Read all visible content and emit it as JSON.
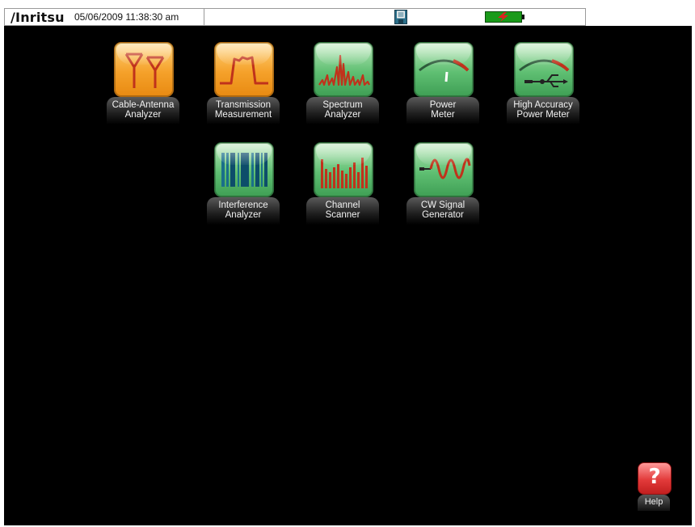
{
  "header": {
    "brand": "/Inritsu",
    "datetime": "05/06/2009 11:38:30 am",
    "save_icon": "floppy-disk-icon",
    "battery_icon": "battery-charging-icon",
    "battery_color": "#1a9a1a",
    "charge_color": "#e02020"
  },
  "apps": [
    {
      "id": "cable-antenna-analyzer",
      "line1": "Cable-Antenna",
      "line2": "Analyzer",
      "icon": "antenna-icon",
      "color": "orange"
    },
    {
      "id": "transmission-measurement",
      "line1": "Transmission",
      "line2": "Measurement",
      "icon": "pulse-icon",
      "color": "orange"
    },
    {
      "id": "spectrum-analyzer",
      "line1": "Spectrum",
      "line2": "Analyzer",
      "icon": "spectrum-icon",
      "color": "green"
    },
    {
      "id": "power-meter",
      "line1": "Power",
      "line2": "Meter",
      "icon": "gauge-icon",
      "color": "green"
    },
    {
      "id": "high-accuracy-power-meter",
      "line1": "High Accuracy",
      "line2": "Power Meter",
      "icon": "usb-gauge-icon",
      "color": "green"
    },
    {
      "id": "interference-analyzer",
      "line1": "Interference",
      "line2": "Analyzer",
      "icon": "barcode-icon",
      "color": "green"
    },
    {
      "id": "channel-scanner",
      "line1": "Channel",
      "line2": "Scanner",
      "icon": "bars-icon",
      "color": "green"
    },
    {
      "id": "cw-signal-generator",
      "line1": "CW Signal",
      "line2": "Generator",
      "icon": "sine-wave-icon",
      "color": "green"
    }
  ],
  "help": {
    "label": "Help",
    "glyph": "?",
    "icon": "help-icon"
  }
}
